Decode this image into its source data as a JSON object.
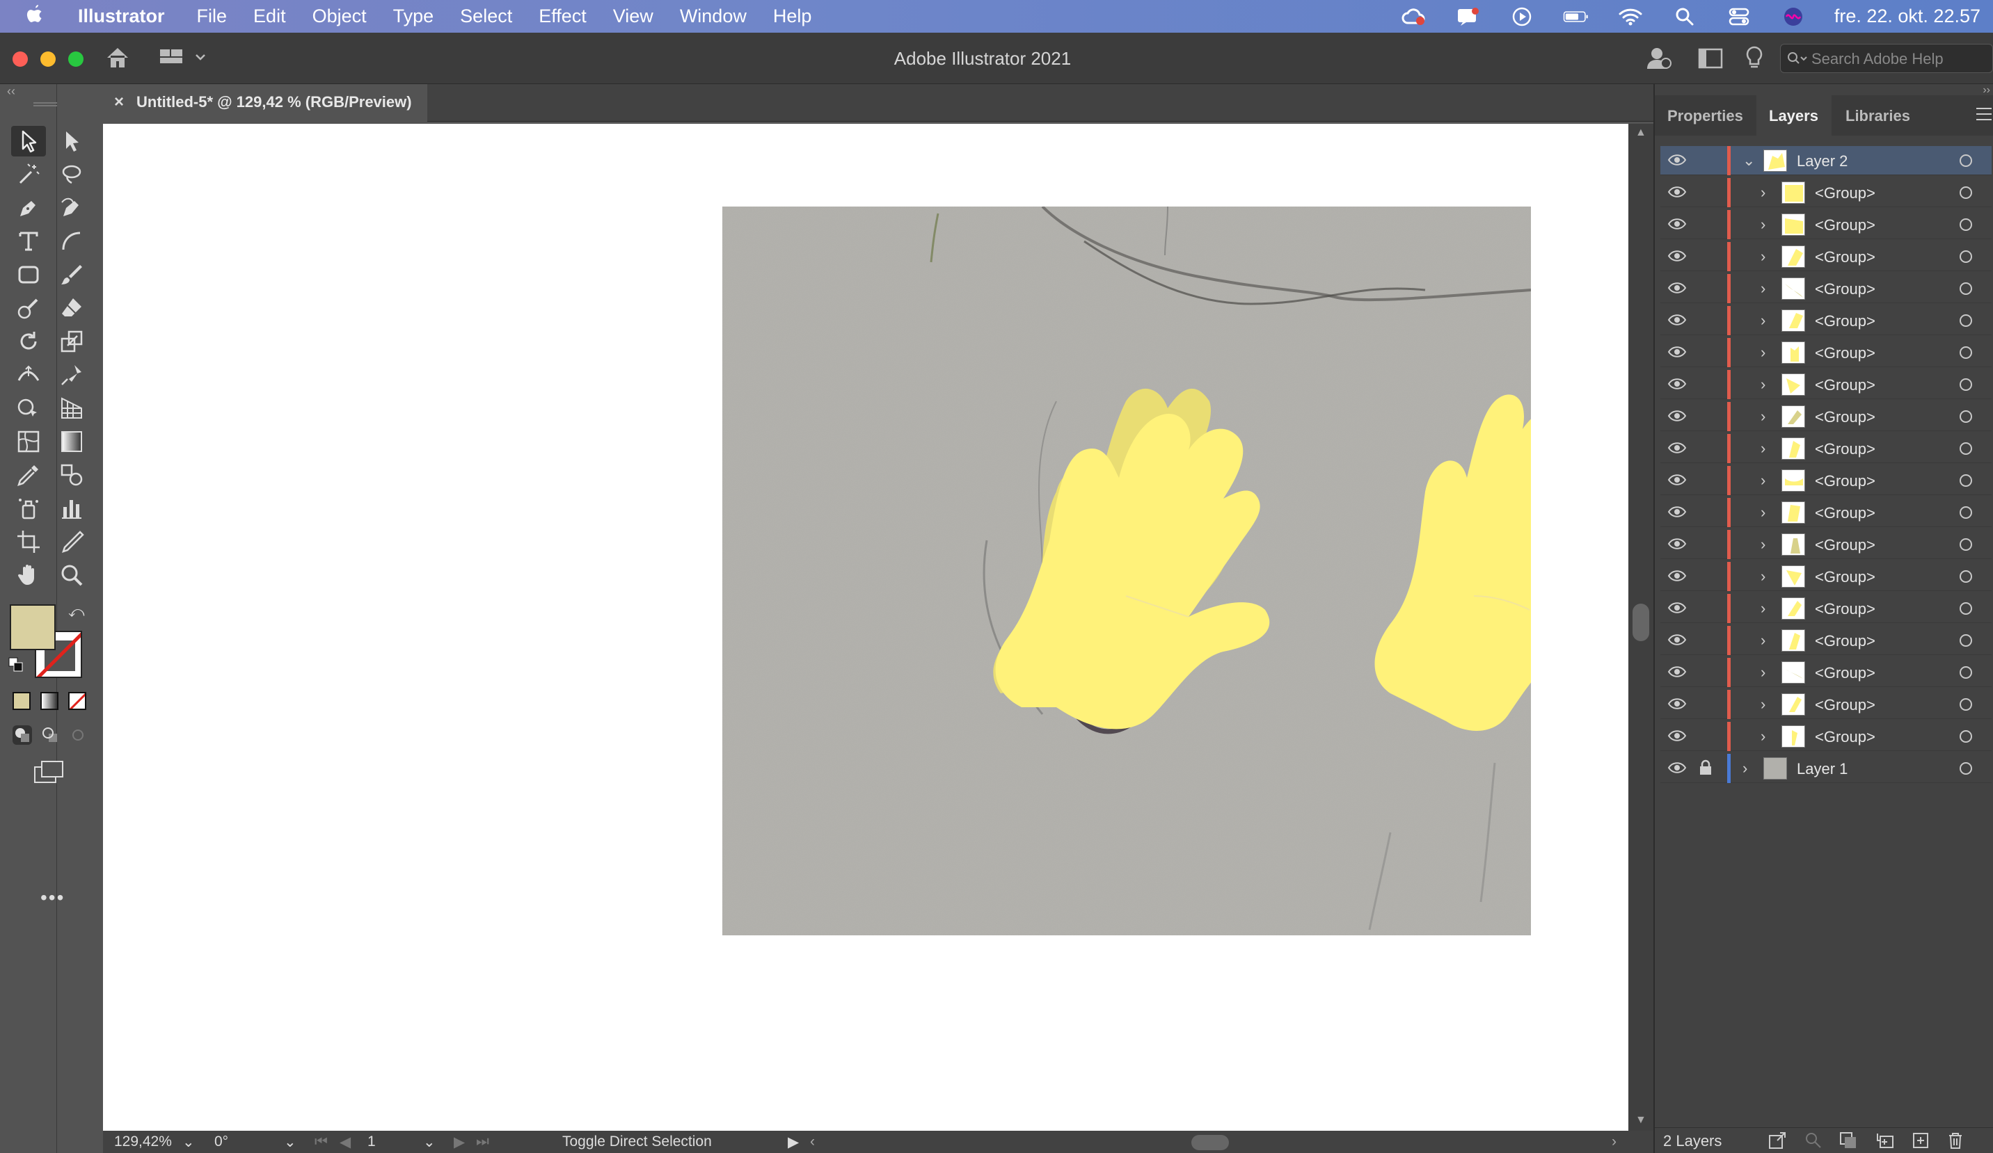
{
  "menubar": {
    "apple_icon": "apple-icon",
    "app_name": "Illustrator",
    "items": [
      "File",
      "Edit",
      "Object",
      "Type",
      "Select",
      "Effect",
      "View",
      "Window",
      "Help"
    ],
    "clock": "fre. 22. okt. 22.57"
  },
  "window": {
    "title": "Adobe Illustrator 2021",
    "search_placeholder": "Search Adobe Help"
  },
  "document": {
    "tab_label": "Untitled-5* @ 129,42 % (RGB/Preview)",
    "close_label": "×"
  },
  "status": {
    "zoom": "129,42%",
    "rotation": "0°",
    "artboard": "1",
    "tool_hint": "Toggle Direct Selection"
  },
  "panel": {
    "tabs": [
      "Properties",
      "Layers",
      "Libraries"
    ],
    "active_tab": "Layers",
    "layers": [
      {
        "name": "Layer 2",
        "level": 0,
        "expanded": true,
        "selected": true,
        "color": "#e05c4d"
      },
      {
        "name": "<Group>",
        "level": 1
      },
      {
        "name": "<Group>",
        "level": 1
      },
      {
        "name": "<Group>",
        "level": 1
      },
      {
        "name": "<Group>",
        "level": 1
      },
      {
        "name": "<Group>",
        "level": 1
      },
      {
        "name": "<Group>",
        "level": 1
      },
      {
        "name": "<Group>",
        "level": 1
      },
      {
        "name": "<Group>",
        "level": 1
      },
      {
        "name": "<Group>",
        "level": 1
      },
      {
        "name": "<Group>",
        "level": 1
      },
      {
        "name": "<Group>",
        "level": 1
      },
      {
        "name": "<Group>",
        "level": 1
      },
      {
        "name": "<Group>",
        "level": 1
      },
      {
        "name": "<Group>",
        "level": 1
      },
      {
        "name": "<Group>",
        "level": 1
      },
      {
        "name": "<Group>",
        "level": 1
      },
      {
        "name": "<Group>",
        "level": 1
      },
      {
        "name": "<Group>",
        "level": 1
      },
      {
        "name": "Layer 1",
        "level": 0,
        "expanded": false,
        "locked": true,
        "color": "#4a7bd6"
      }
    ],
    "footer_count": "2 Layers"
  },
  "colors": {
    "fill_swatch": "#d9d0a0",
    "glove_yellow": "#fff27a",
    "paper_gray": "#b1b0ab"
  }
}
